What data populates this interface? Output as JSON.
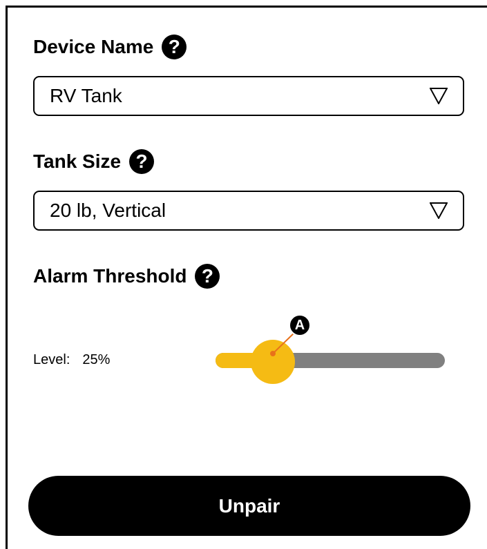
{
  "device_name": {
    "title": "Device Name",
    "help_icon": "question-circle-icon",
    "selected": "RV Tank"
  },
  "tank_size": {
    "title": "Tank Size",
    "help_icon": "question-circle-icon",
    "selected": "20 lb, Vertical"
  },
  "alarm_threshold": {
    "title": "Alarm Threshold",
    "help_icon": "question-circle-icon",
    "level_label": "Level:",
    "level_value": "25%",
    "slider_fraction": 0.25,
    "callout_label": "A"
  },
  "actions": {
    "unpair_label": "Unpair"
  },
  "colors": {
    "accent": "#f5bb14",
    "track": "#808080",
    "button_bg": "#000000"
  }
}
